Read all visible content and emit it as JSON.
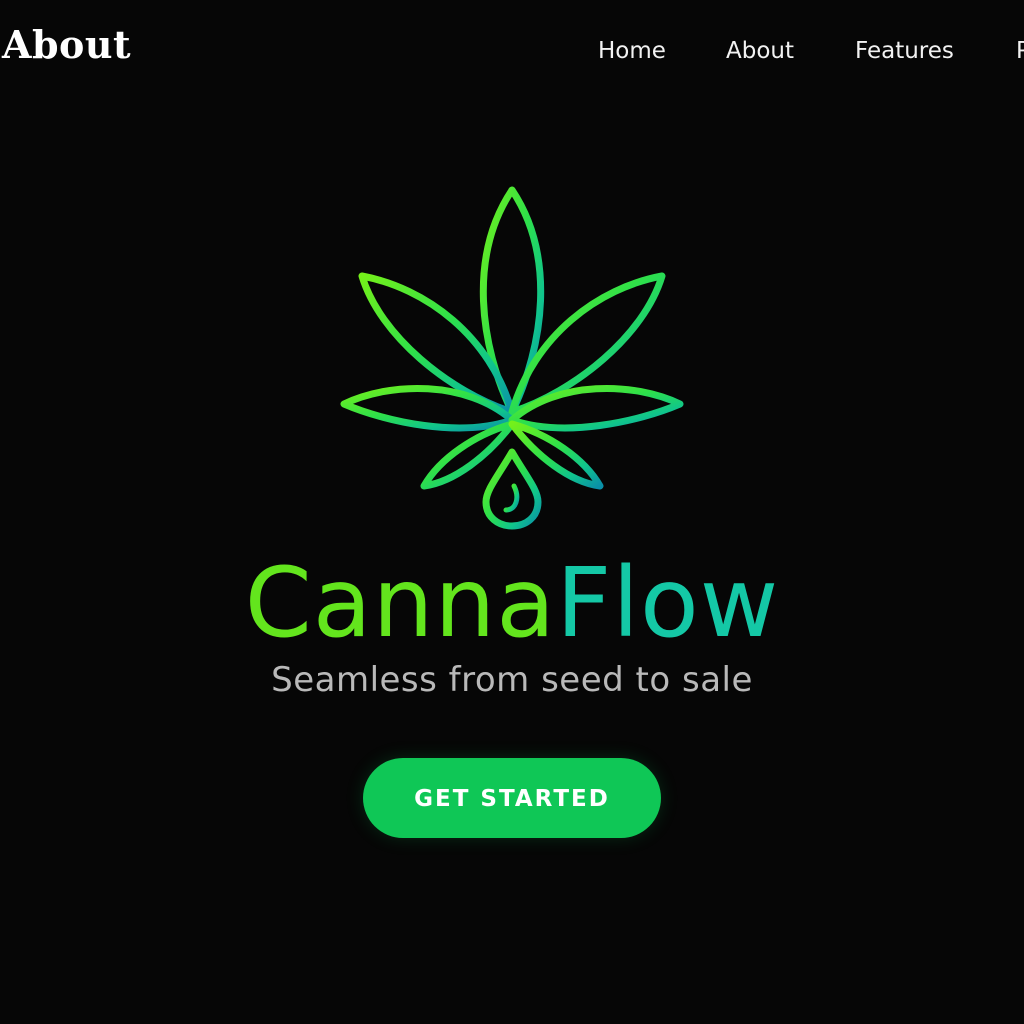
{
  "header": {
    "brand": "About",
    "nav": {
      "home": "Home",
      "about": "About",
      "features": "Features",
      "more": "P"
    }
  },
  "hero": {
    "logo_icon": "cannabis-leaf-with-droplet",
    "brand_part1": "Canna",
    "brand_part2": "Flow",
    "tagline": "Seamless from seed to sale",
    "cta_label": "GET STARTED"
  },
  "colors": {
    "background": "#060606",
    "accent_green": "#63e51d",
    "accent_teal": "#14c8a6",
    "cta_green": "#0fc756",
    "tagline_gray": "#b9b9b9"
  }
}
